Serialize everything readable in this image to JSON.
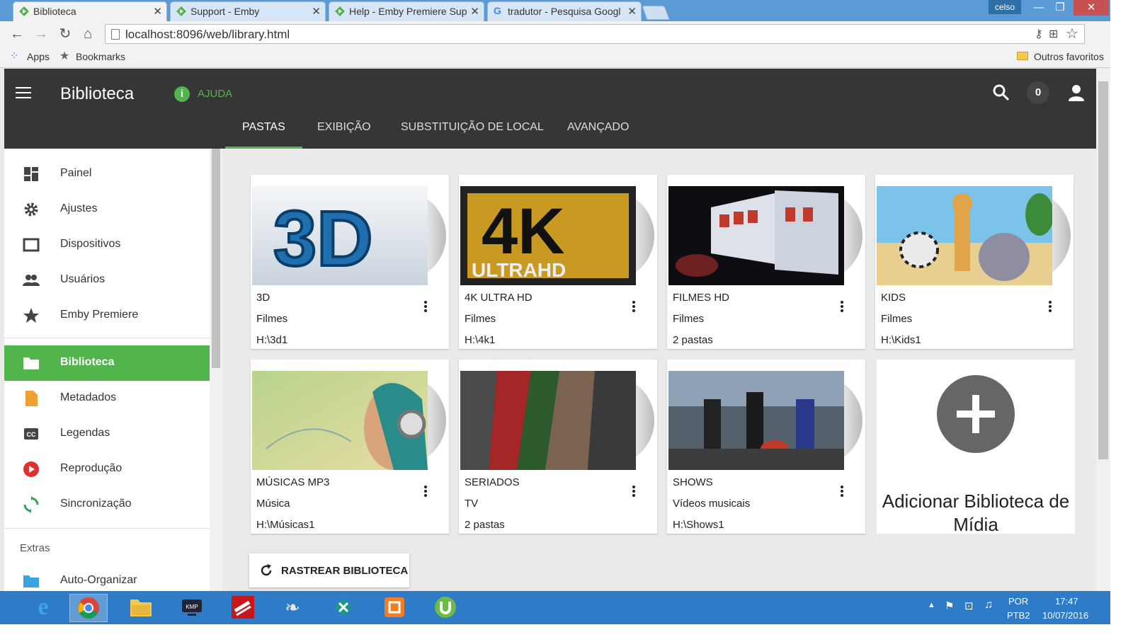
{
  "browser": {
    "tabs": [
      {
        "title": "Biblioteca",
        "active": true
      },
      {
        "title": "Support - Emby",
        "active": false
      },
      {
        "title": "Help - Emby Premiere Sup",
        "active": false
      },
      {
        "title": "tradutor - Pesquisa Googl",
        "active": false
      }
    ],
    "user_label": "celso",
    "url": "localhost:8096/web/library.html",
    "bookmarks": {
      "apps": "Apps",
      "bookmarks": "Bookmarks",
      "other": "Outros favoritos"
    }
  },
  "header": {
    "title": "Biblioteca",
    "help_label": "AJUDA",
    "notification_count": "0",
    "tabs": [
      {
        "label": "PASTAS",
        "active": true
      },
      {
        "label": "EXIBIÇÃO",
        "active": false
      },
      {
        "label": "SUBSTITUIÇÃO DE LOCAL",
        "active": false
      },
      {
        "label": "AVANÇADO",
        "active": false
      }
    ]
  },
  "sidebar": {
    "items": [
      {
        "label": "Painel",
        "icon": "dashboard-icon"
      },
      {
        "label": "Ajustes",
        "icon": "gear-icon"
      },
      {
        "label": "Dispositivos",
        "icon": "tablet-icon"
      },
      {
        "label": "Usuários",
        "icon": "people-icon"
      },
      {
        "label": "Emby Premiere",
        "icon": "star-icon"
      },
      {
        "label": "Biblioteca",
        "icon": "folder-icon",
        "active": true
      },
      {
        "label": "Metadados",
        "icon": "document-icon"
      },
      {
        "label": "Legendas",
        "icon": "closed-caption-icon"
      },
      {
        "label": "Reprodução",
        "icon": "play-icon"
      },
      {
        "label": "Sincronização",
        "icon": "sync-icon"
      }
    ],
    "extras_label": "Extras",
    "extras_items": [
      {
        "label": "Auto-Organizar",
        "icon": "folder-icon"
      }
    ]
  },
  "libraries": [
    {
      "name": "3D",
      "type": "Filmes",
      "path": "H:\\3d1",
      "art": "3d"
    },
    {
      "name": "4K ULTRA HD",
      "type": "Filmes",
      "path": "H:\\4k1",
      "art": "4k"
    },
    {
      "name": "FILMES HD",
      "type": "Filmes",
      "path": "2 pastas",
      "art": "filmes"
    },
    {
      "name": "KIDS",
      "type": "Filmes",
      "path": "H:\\Kids1",
      "art": "kids"
    },
    {
      "name": "MÚSICAS MP3",
      "type": "Música",
      "path": "H:\\Músicas1",
      "art": "musica"
    },
    {
      "name": "SERIADOS",
      "type": "TV",
      "path": "2 pastas",
      "art": "series"
    },
    {
      "name": "SHOWS",
      "type": "Vídeos musicais",
      "path": "H:\\Shows1",
      "art": "shows"
    }
  ],
  "add_library_label": "Adicionar Biblioteca de Mídia",
  "scan_button_label": "RASTREAR BIBLIOTECA",
  "taskbar": {
    "apps": [
      "internet-explorer-icon",
      "chrome-icon",
      "file-explorer-icon",
      "media-player-icon",
      "emby-icon",
      "scorpion-icon",
      "bug-icon",
      "puzzle-icon",
      "utorrent-icon"
    ],
    "lang": "POR",
    "layout": "PTB2",
    "time": "17:47",
    "date": "10/07/2016"
  },
  "colors": {
    "accent": "#52b54b",
    "header": "#363636",
    "taskbar": "#2e7bc7"
  }
}
